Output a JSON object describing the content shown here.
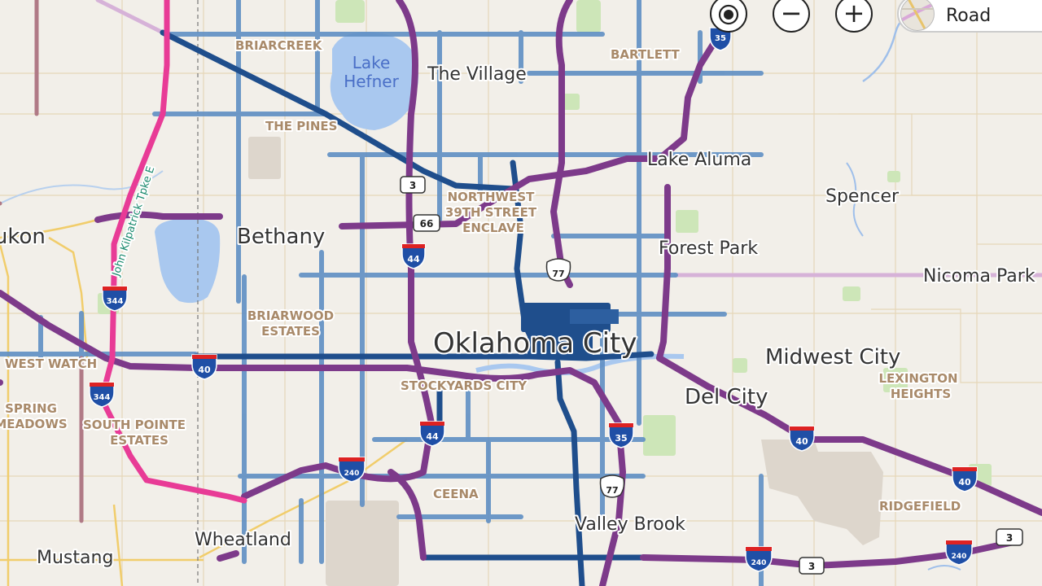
{
  "controls": {
    "locate_icon": "locate-icon",
    "zoom_out_label": "−",
    "zoom_in_label": "+",
    "map_style_label": "Road"
  },
  "colors": {
    "land": "#f2efe9",
    "water": "#a9c8ef",
    "traffic_heavy": "#1f4e8c",
    "traffic_moderate": "#6f9ac7",
    "traffic_purple": "#7d3a8a",
    "traffic_pink": "#e83b96"
  },
  "places": {
    "yukon": "Yukon",
    "bethany": "Bethany",
    "the_village": "The Village",
    "lake_aluma": "Lake Aluma",
    "spencer": "Spencer",
    "forest_park": "Forest Park",
    "nicoma_park": "Nicoma Park",
    "oklahoma_city": "Oklahoma City",
    "midwest_city": "Midwest City",
    "del_city": "Del City",
    "valley_brook": "Valley Brook",
    "wheatland": "Wheatland",
    "mustang": "Mustang"
  },
  "neighborhoods": {
    "briarcreek": "BRIARCREEK",
    "bartlett": "BARTLETT",
    "the_pines": "THE PINES",
    "northwest_39th_1": "NORTHWEST",
    "northwest_39th_2": "39TH STREET",
    "northwest_39th_3": "ENCLAVE",
    "briarwood_1": "BRIARWOOD",
    "briarwood_2": "ESTATES",
    "west_watch": "WEST WATCH",
    "spring_meadows_1": "SPRING",
    "spring_meadows_2": "MEADOWS",
    "south_pointe_1": "SOUTH POINTE",
    "south_pointe_2": "ESTATES",
    "stockyards_city": "STOCKYARDS CITY",
    "ceena": "CEENA",
    "lexington_heights_1": "LEXINGTON",
    "lexington_heights_2": "HEIGHTS",
    "ridgefield": "RIDGEFIELD"
  },
  "water": {
    "lake_hefner_1": "Lake",
    "lake_hefner_2": "Hefner"
  },
  "roads": {
    "turnpike_label": "John Kilpatrick Tpke E"
  },
  "shields": {
    "i35_top": "35",
    "us3_a": "3",
    "us66": "66",
    "i44_north": "44",
    "us77_north": "77",
    "i344_north": "344",
    "i40_west": "40",
    "i344_south": "344",
    "i44_south": "44",
    "i35_south": "35",
    "i40_east_a": "40",
    "i40_east_b": "40",
    "i240_west": "240",
    "us77_south": "77",
    "i240_mid": "240",
    "us3_b": "3",
    "i240_east": "240",
    "us3_c": "3"
  }
}
